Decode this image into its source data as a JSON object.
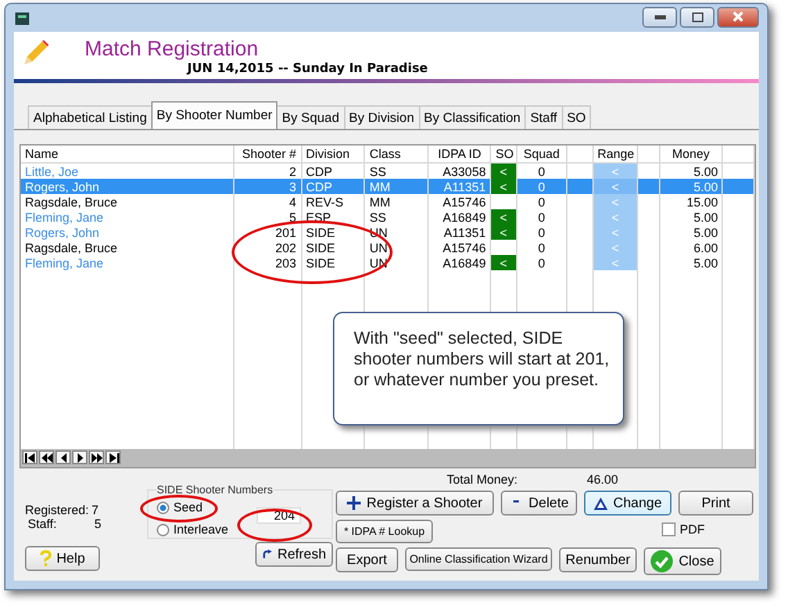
{
  "header": {
    "title": "Match Registration",
    "subtitle": "JUN 14,2015 -- Sunday In Paradise"
  },
  "tabs": [
    {
      "label": "Alphabetical Listing",
      "selected": false
    },
    {
      "label": "By Shooter Number",
      "selected": true
    },
    {
      "label": "By Squad",
      "selected": false
    },
    {
      "label": "By Division",
      "selected": false
    },
    {
      "label": "By Classification",
      "selected": false
    },
    {
      "label": "Staff",
      "selected": false
    },
    {
      "label": "SO",
      "selected": false
    }
  ],
  "table": {
    "columns": [
      "Name",
      "Shooter #",
      "Division",
      "Class",
      "IDPA ID",
      "SO",
      "Squad",
      "Range",
      "Money"
    ],
    "rows": [
      {
        "name": "Little, Joe",
        "shooter": "2",
        "division": "CDP",
        "class": "SS",
        "idpa_id": "A33058",
        "so": true,
        "so_mark": "<",
        "squad": "0",
        "range": "<",
        "money": "5.00",
        "color": "#3a8ee6",
        "selected": false
      },
      {
        "name": "Rogers, John",
        "shooter": "3",
        "division": "CDP",
        "class": "MM",
        "idpa_id": "A11351",
        "so": true,
        "so_mark": "<",
        "squad": "0",
        "range": "<",
        "money": "5.00",
        "selected": true
      },
      {
        "name": "Ragsdale, Bruce",
        "shooter": "4",
        "division": "REV-S",
        "class": "MM",
        "idpa_id": "A15746",
        "so": false,
        "squad": "0",
        "range": "<",
        "money": "15.00",
        "color": "#000000",
        "selected": false
      },
      {
        "name": "Fleming, Jane",
        "shooter": "5",
        "division": "ESP",
        "class": "SS",
        "idpa_id": "A16849",
        "so": true,
        "so_mark": "<",
        "squad": "0",
        "range": "<",
        "money": "5.00",
        "color": "#3a8ee6",
        "selected": false
      },
      {
        "name": "Rogers, John",
        "shooter": "201",
        "division": "SIDE",
        "class": "UN",
        "idpa_id": "A11351",
        "so": true,
        "so_mark": "<",
        "squad": "0",
        "range": "<",
        "money": "5.00",
        "color": "#3a8ee6",
        "selected": false
      },
      {
        "name": "Ragsdale, Bruce",
        "shooter": "202",
        "division": "SIDE",
        "class": "UN",
        "idpa_id": "A15746",
        "so": false,
        "squad": "0",
        "range": "<",
        "money": "6.00",
        "color": "#000000",
        "selected": false
      },
      {
        "name": "Fleming, Jane",
        "shooter": "203",
        "division": "SIDE",
        "class": "UN",
        "idpa_id": "A16849",
        "so": true,
        "so_mark": "<",
        "squad": "0",
        "range": "<",
        "money": "5.00",
        "color": "#3a8ee6",
        "selected": false
      }
    ]
  },
  "callout": "With \"seed\" selected, SIDE shooter numbers will start at 201, or whatever number you preset.",
  "total_money": {
    "label": "Total Money:",
    "value": "46.00"
  },
  "stats": [
    {
      "label": "Registered:",
      "value": "7"
    },
    {
      "label": "Staff:",
      "value": "5"
    }
  ],
  "side_numbers": {
    "title": "SIDE Shooter Numbers",
    "options": [
      {
        "label": "Seed",
        "selected": true
      },
      {
        "label": "Interleave",
        "selected": false
      }
    ],
    "start_value": "204"
  },
  "buttons": [
    {
      "label": "Register a Shooter",
      "kind": "plus"
    },
    {
      "label": "Delete",
      "kind": "minus"
    },
    {
      "label": "Change",
      "kind": "triangle"
    },
    {
      "label": "Print",
      "kind": "plain"
    },
    {
      "label": "* IDPA # Lookup",
      "kind": "plain"
    },
    {
      "label": "Help",
      "kind": "question"
    },
    {
      "label": "Refresh",
      "kind": "refresh"
    },
    {
      "label": "Export",
      "kind": "plain"
    },
    {
      "label": "Online Classification Wizard",
      "kind": "plain"
    },
    {
      "label": "Renumber",
      "kind": "plain"
    },
    {
      "label": "Close",
      "kind": "check"
    }
  ],
  "pdf": {
    "label": "PDF",
    "checked": false
  }
}
